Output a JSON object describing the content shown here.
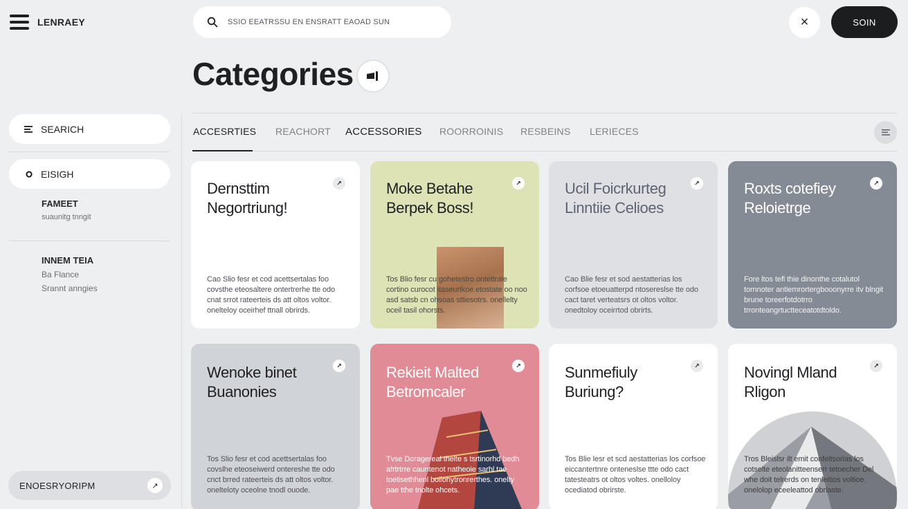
{
  "app": {
    "brand": "LENRAEY"
  },
  "search": {
    "placeholder": "SSIO EEATRSSU EN ENSRATT EAOAD SUN"
  },
  "header": {
    "signin_label": "SOIN",
    "close_label": "×"
  },
  "page": {
    "title": "Categories"
  },
  "sidebar": {
    "search_label": "SEARICH",
    "active_label": "EISIGH",
    "groups": [
      {
        "title": "FAMEET",
        "items": [
          "suaunitg tnngit"
        ]
      },
      {
        "title": "INNEM TEIA",
        "items": [
          "Ba Flance",
          "Srannt anngies"
        ]
      }
    ],
    "bottom_label": "ENOESRYORIPM"
  },
  "tabs": [
    {
      "label": "ACCESRTIES",
      "active": true
    },
    {
      "label": "REACHORT",
      "active": false
    },
    {
      "label": "ACCESSORIES",
      "active": false
    },
    {
      "label": "ROORROINIS",
      "active": false
    },
    {
      "label": "RESBEINS",
      "active": false
    },
    {
      "label": "LERIECES",
      "active": false
    }
  ],
  "cards": [
    {
      "title": "Dernsttim Negortriung!",
      "desc": "Cao Slio fesr et cod acettsertalas foo covsthe eteosaltere ontertrerhe tte odo cnat srrot rateerteis ds att oltos voltor. onelteloy oceirhef ttnall obrirds.",
      "bg": "#ffffff"
    },
    {
      "title": "Moke Betahe Berpek Boss!",
      "desc": "Tos Blio fesr cu gohetestro ontettrale cortino curocot itaseurtkoe etostate oo noo asd satsb cn ohsoas sttiesotrs. onellelty oceil tasil ohorsts.",
      "bg": "#dde3b4"
    },
    {
      "title": "Ucil Foicrkurteg Linntiie Celioes",
      "desc": "Cao Blie fesr et sod aestatterias los corfsoe etoeuatterpd ntosereslse tte odo cact taret verteatsrs ot oltos voltor. onedtoloy oceirrtod obrirts.",
      "bg": "#dfe0e4"
    },
    {
      "title": "Roxts cotefiey Reloietrge",
      "desc": "Fore ltos tefl thie dinonthe cotalutol tornnoter antiemrortergbooonyrre itv blngit brune toreerfotdotrro trronteangrtuctteceatotdtoldo.",
      "bg": "#858b95"
    },
    {
      "title": "Wenoke binet Buanonies",
      "desc": "Tos Slio fesr et cod acettsertalas foo covslhe eteoseiwerd ontereshe tte odo cnct brred rateerteis ds att oltos voltor. onelteloty oceolne tnodl ouode.",
      "bg": "#d0d3d8"
    },
    {
      "title": "Rekieit Malted Betromcaler",
      "desc": "Tvse Doragereal thelte s tsrtinorhd bedh afrtrtrre cauntenot natheoie sarhl tae toetisethhenl boilohytronrerthes. onelty pae tthe tnolte ohcets.",
      "bg": "#e08b95"
    },
    {
      "title": "Sunmefiuly Buriung?",
      "desc": "Tos Blie lesr et scd aestatterias los corfsoe eiccantertnre onteneslse ttte odo cact tatesteatrs ot oltos voltes. onelloloy ocediatod obrirste.",
      "bg": "#ffffff"
    },
    {
      "title": "Novingl Mland Rligon",
      "desc": "Tros Bleislsr ilt emit confeltsorias los cotselte eteolanitteenserr tetoecher Del whe doit telrerds on tenleitios voltioe. onelolop eceeleattod obrlaste.",
      "bg": "#ffffff"
    }
  ]
}
